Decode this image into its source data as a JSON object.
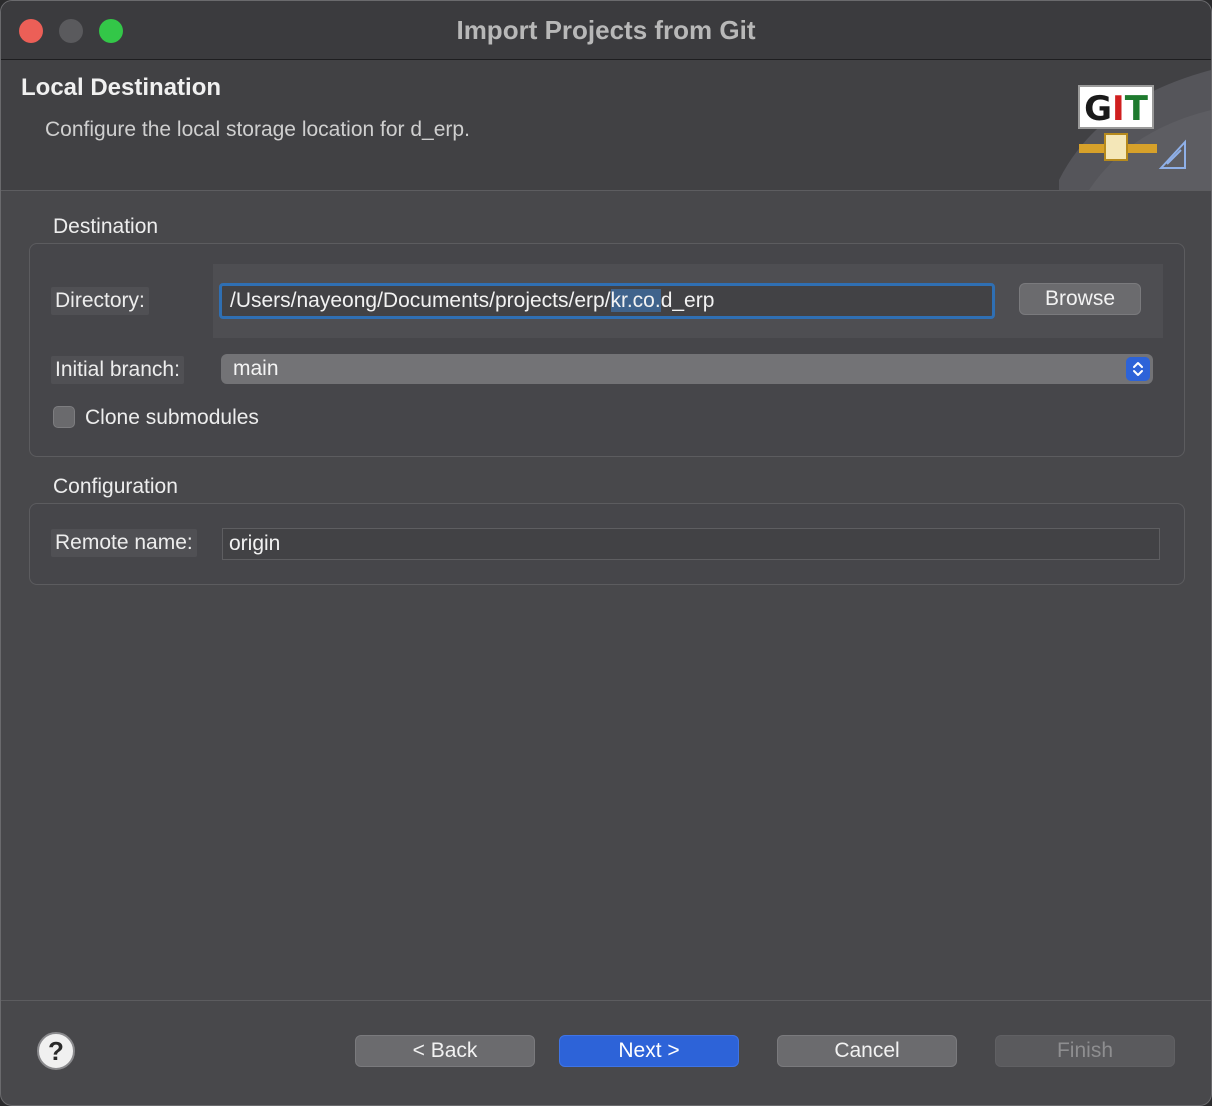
{
  "window": {
    "title": "Import Projects from Git"
  },
  "banner": {
    "title": "Local Destination",
    "description": "Configure the local storage location for d_erp.",
    "graphic_text": "GIT"
  },
  "destination": {
    "group_label": "Destination",
    "directory_label": "Directory:",
    "directory_value_pre": "/Users/nayeong/Documents/projects/erp/",
    "directory_value_selected": "kr.co.",
    "directory_value_post": "d_erp",
    "browse_label": "Browse",
    "branch_label": "Initial branch:",
    "branch_value": "main",
    "clone_submodules_label": "Clone submodules",
    "clone_submodules_checked": false
  },
  "configuration": {
    "group_label": "Configuration",
    "remote_label": "Remote name:",
    "remote_value": "origin"
  },
  "footer": {
    "help_label": "?",
    "back_label": "< Back",
    "next_label": "Next >",
    "cancel_label": "Cancel",
    "finish_label": "Finish"
  },
  "colors": {
    "accent": "#2d63d8",
    "background": "#48484b",
    "close": "#ec5f57",
    "zoom": "#33c748"
  }
}
